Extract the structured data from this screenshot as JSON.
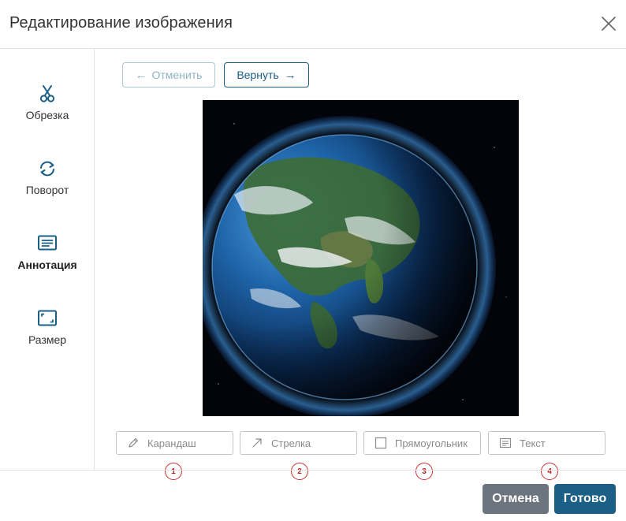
{
  "dialog": {
    "title": "Редактирование изображения",
    "close_icon": "close-icon"
  },
  "sidebar": {
    "items": [
      {
        "label": "Обрезка",
        "icon": "scissors-icon",
        "active": false
      },
      {
        "label": "Поворот",
        "icon": "rotate-icon",
        "active": false
      },
      {
        "label": "Аннотация",
        "icon": "annotation-icon",
        "active": true
      },
      {
        "label": "Размер",
        "icon": "resize-icon",
        "active": false
      }
    ]
  },
  "history": {
    "undo_label": "Отменить",
    "undo_arrow": "←",
    "redo_label": "Вернуть",
    "redo_arrow": "→"
  },
  "annotation_tools": [
    {
      "label": "Карандаш",
      "icon": "pencil-icon",
      "marker": "1"
    },
    {
      "label": "Стрелка",
      "icon": "arrow-icon",
      "marker": "2"
    },
    {
      "label": "Прямоугольник",
      "icon": "rectangle-icon",
      "marker": "3"
    },
    {
      "label": "Текст",
      "icon": "text-icon",
      "marker": "4"
    }
  ],
  "footer": {
    "cancel_label": "Отмена",
    "done_label": "Готово"
  },
  "colors": {
    "accent": "#1b5f87",
    "cancel": "#6c757d",
    "marker": "#cc2f2f",
    "icon": "#1b5f87"
  }
}
